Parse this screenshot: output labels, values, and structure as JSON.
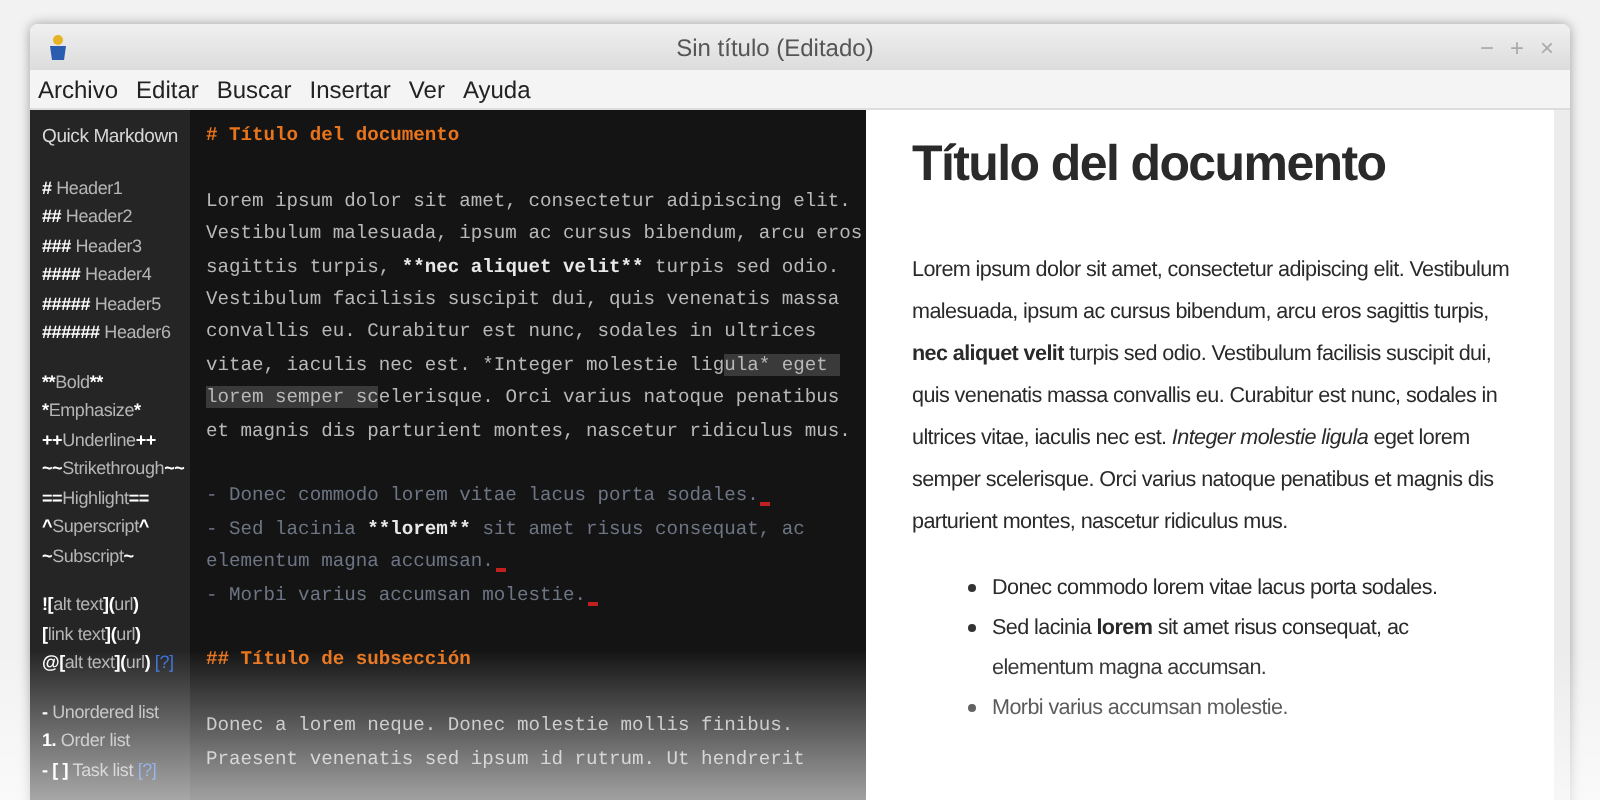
{
  "window": {
    "title": "Sin título (Editado)",
    "controls": [
      "−",
      "+",
      "×"
    ]
  },
  "menu": [
    "Archivo",
    "Editar",
    "Buscar",
    "Insertar",
    "Ver",
    "Ayuda"
  ],
  "sidebar": {
    "title": "Quick Markdown",
    "groups": [
      [
        [
          {
            "text": "#",
            "kind": "syntax"
          },
          {
            "text": " Header1",
            "kind": "label"
          }
        ],
        [
          {
            "text": "##",
            "kind": "syntax"
          },
          {
            "text": " Header2",
            "kind": "label"
          }
        ],
        [
          {
            "text": "###",
            "kind": "syntax"
          },
          {
            "text": " Header3",
            "kind": "label"
          }
        ],
        [
          {
            "text": "####",
            "kind": "syntax"
          },
          {
            "text": " Header4",
            "kind": "label"
          }
        ],
        [
          {
            "text": "#####",
            "kind": "syntax"
          },
          {
            "text": " Header5",
            "kind": "label"
          }
        ],
        [
          {
            "text": "######",
            "kind": "syntax"
          },
          {
            "text": " Header6",
            "kind": "label"
          }
        ]
      ],
      [
        [
          {
            "text": "**",
            "kind": "syntax"
          },
          {
            "text": "Bold",
            "kind": "label"
          },
          {
            "text": "**",
            "kind": "syntax"
          }
        ],
        [
          {
            "text": "*",
            "kind": "syntax"
          },
          {
            "text": "Emphasize",
            "kind": "label"
          },
          {
            "text": "*",
            "kind": "syntax"
          }
        ],
        [
          {
            "text": "++",
            "kind": "syntax"
          },
          {
            "text": "Underline",
            "kind": "label"
          },
          {
            "text": "++",
            "kind": "syntax"
          }
        ],
        [
          {
            "text": "~~",
            "kind": "syntax"
          },
          {
            "text": "Strikethrough",
            "kind": "label"
          },
          {
            "text": "~~",
            "kind": "syntax"
          }
        ],
        [
          {
            "text": "==",
            "kind": "syntax"
          },
          {
            "text": "Highlight",
            "kind": "label"
          },
          {
            "text": "==",
            "kind": "syntax"
          }
        ],
        [
          {
            "text": "^",
            "kind": "syntax"
          },
          {
            "text": "Superscript",
            "kind": "label"
          },
          {
            "text": "^",
            "kind": "syntax"
          }
        ],
        [
          {
            "text": "~",
            "kind": "syntax"
          },
          {
            "text": "Subscript",
            "kind": "label"
          },
          {
            "text": "~",
            "kind": "syntax"
          }
        ]
      ],
      [
        [
          {
            "text": "![",
            "kind": "syntax"
          },
          {
            "text": "alt text",
            "kind": "label"
          },
          {
            "text": "](",
            "kind": "syntax"
          },
          {
            "text": "url",
            "kind": "label"
          },
          {
            "text": ")",
            "kind": "syntax"
          }
        ],
        [
          {
            "text": "[",
            "kind": "syntax"
          },
          {
            "text": "link text",
            "kind": "label"
          },
          {
            "text": "](",
            "kind": "syntax"
          },
          {
            "text": "url",
            "kind": "label"
          },
          {
            "text": ")",
            "kind": "syntax"
          }
        ],
        [
          {
            "text": "@[",
            "kind": "syntax"
          },
          {
            "text": "alt text",
            "kind": "label"
          },
          {
            "text": "](",
            "kind": "syntax"
          },
          {
            "text": "url",
            "kind": "label"
          },
          {
            "text": ") ",
            "kind": "syntax"
          },
          {
            "text": "[?]",
            "kind": "help"
          }
        ]
      ],
      [
        [
          {
            "text": "- ",
            "kind": "syntax"
          },
          {
            "text": "Unordered list",
            "kind": "label"
          }
        ],
        [
          {
            "text": "1. ",
            "kind": "syntax"
          },
          {
            "text": "Order list",
            "kind": "label"
          }
        ],
        [
          {
            "text": "- [ ] ",
            "kind": "syntax"
          },
          {
            "text": "Task list ",
            "kind": "label"
          },
          {
            "text": "[?]",
            "kind": "help"
          }
        ]
      ]
    ]
  },
  "editor": {
    "lines": [
      {
        "kind": "heading",
        "segments": [
          {
            "text": "# Título del documento",
            "kind": "plain"
          }
        ]
      },
      {
        "kind": "blank"
      },
      {
        "kind": "text",
        "segments": [
          {
            "text": "Lorem ipsum dolor sit amet, consectetur adipiscing elit.",
            "kind": "plain"
          }
        ]
      },
      {
        "kind": "text",
        "segments": [
          {
            "text": "Vestibulum malesuada, ipsum ac cursus bibendum, arcu eros",
            "kind": "plain"
          }
        ]
      },
      {
        "kind": "text",
        "segments": [
          {
            "text": "sagittis turpis, ",
            "kind": "plain"
          },
          {
            "text": "**nec aliquet velit**",
            "kind": "bold"
          },
          {
            "text": " turpis sed odio.",
            "kind": "plain"
          }
        ]
      },
      {
        "kind": "text",
        "segments": [
          {
            "text": "Vestibulum facilisis suscipit dui, quis venenatis massa",
            "kind": "plain"
          }
        ]
      },
      {
        "kind": "text",
        "segments": [
          {
            "text": "convallis eu. Curabitur est nunc, sodales in ultrices",
            "kind": "plain"
          }
        ]
      },
      {
        "kind": "text",
        "segments": [
          {
            "text": "vitae, iaculis nec est. *Integer molestie lig",
            "kind": "plain"
          },
          {
            "text": "ula* eget ",
            "kind": "selection"
          }
        ]
      },
      {
        "kind": "text",
        "segments": [
          {
            "text": "lorem semper sc",
            "kind": "selection"
          },
          {
            "text": "elerisque. Orci varius natoque penatibus",
            "kind": "plain"
          }
        ]
      },
      {
        "kind": "text",
        "segments": [
          {
            "text": "et magnis dis parturient montes, nascetur ridiculus mus.",
            "kind": "plain"
          }
        ]
      },
      {
        "kind": "blank"
      },
      {
        "kind": "list",
        "marked": true,
        "segments": [
          {
            "text": "- Donec commodo lorem vitae lacus porta sodales.",
            "kind": "plain"
          }
        ]
      },
      {
        "kind": "list",
        "marked": false,
        "segments": [
          {
            "text": "- Sed lacinia ",
            "kind": "plain"
          },
          {
            "text": "**lorem**",
            "kind": "bold"
          },
          {
            "text": " sit amet risus consequat, ac",
            "kind": "plain"
          }
        ]
      },
      {
        "kind": "list",
        "marked": true,
        "segments": [
          {
            "text": "elementum magna accumsan.",
            "kind": "plain"
          }
        ]
      },
      {
        "kind": "list",
        "marked": true,
        "segments": [
          {
            "text": "- Morbi varius accumsan molestie.",
            "kind": "plain"
          }
        ]
      },
      {
        "kind": "blank"
      },
      {
        "kind": "heading",
        "segments": [
          {
            "text": "## Título de subsección",
            "kind": "plain"
          }
        ]
      },
      {
        "kind": "blank"
      },
      {
        "kind": "text",
        "segments": [
          {
            "text": "Donec a lorem neque. Donec molestie mollis finibus.",
            "kind": "plain"
          }
        ]
      },
      {
        "kind": "text",
        "segments": [
          {
            "text": "Praesent venenatis sed ipsum id rutrum. Ut hendrerit",
            "kind": "plain"
          }
        ]
      }
    ]
  },
  "preview": {
    "title": "Título del documento",
    "paragraph": "Lorem ipsum dolor sit amet, consectetur adipiscing elit. Vestibulum malesuada, ipsum ac cursus bibendum, arcu eros sagittis turpis, **nec aliquet velit** turpis sed odio. Vestibulum facilisis suscipit dui, quis venenatis massa convallis eu. Curabitur est nunc, sodales in ultrices vitae, iaculis nec est. *Integer molestie ligula* eget lorem semper scelerisque. Orci varius natoque penatibus et magnis dis parturient montes, nascetur ridiculus mus.",
    "list": [
      "Donec commodo lorem vitae lacus porta sodales.",
      "Sed lacinia **lorem** sit amet risus consequat, ac elementum magna accumsan.",
      "Morbi varius accumsan molestie."
    ]
  }
}
